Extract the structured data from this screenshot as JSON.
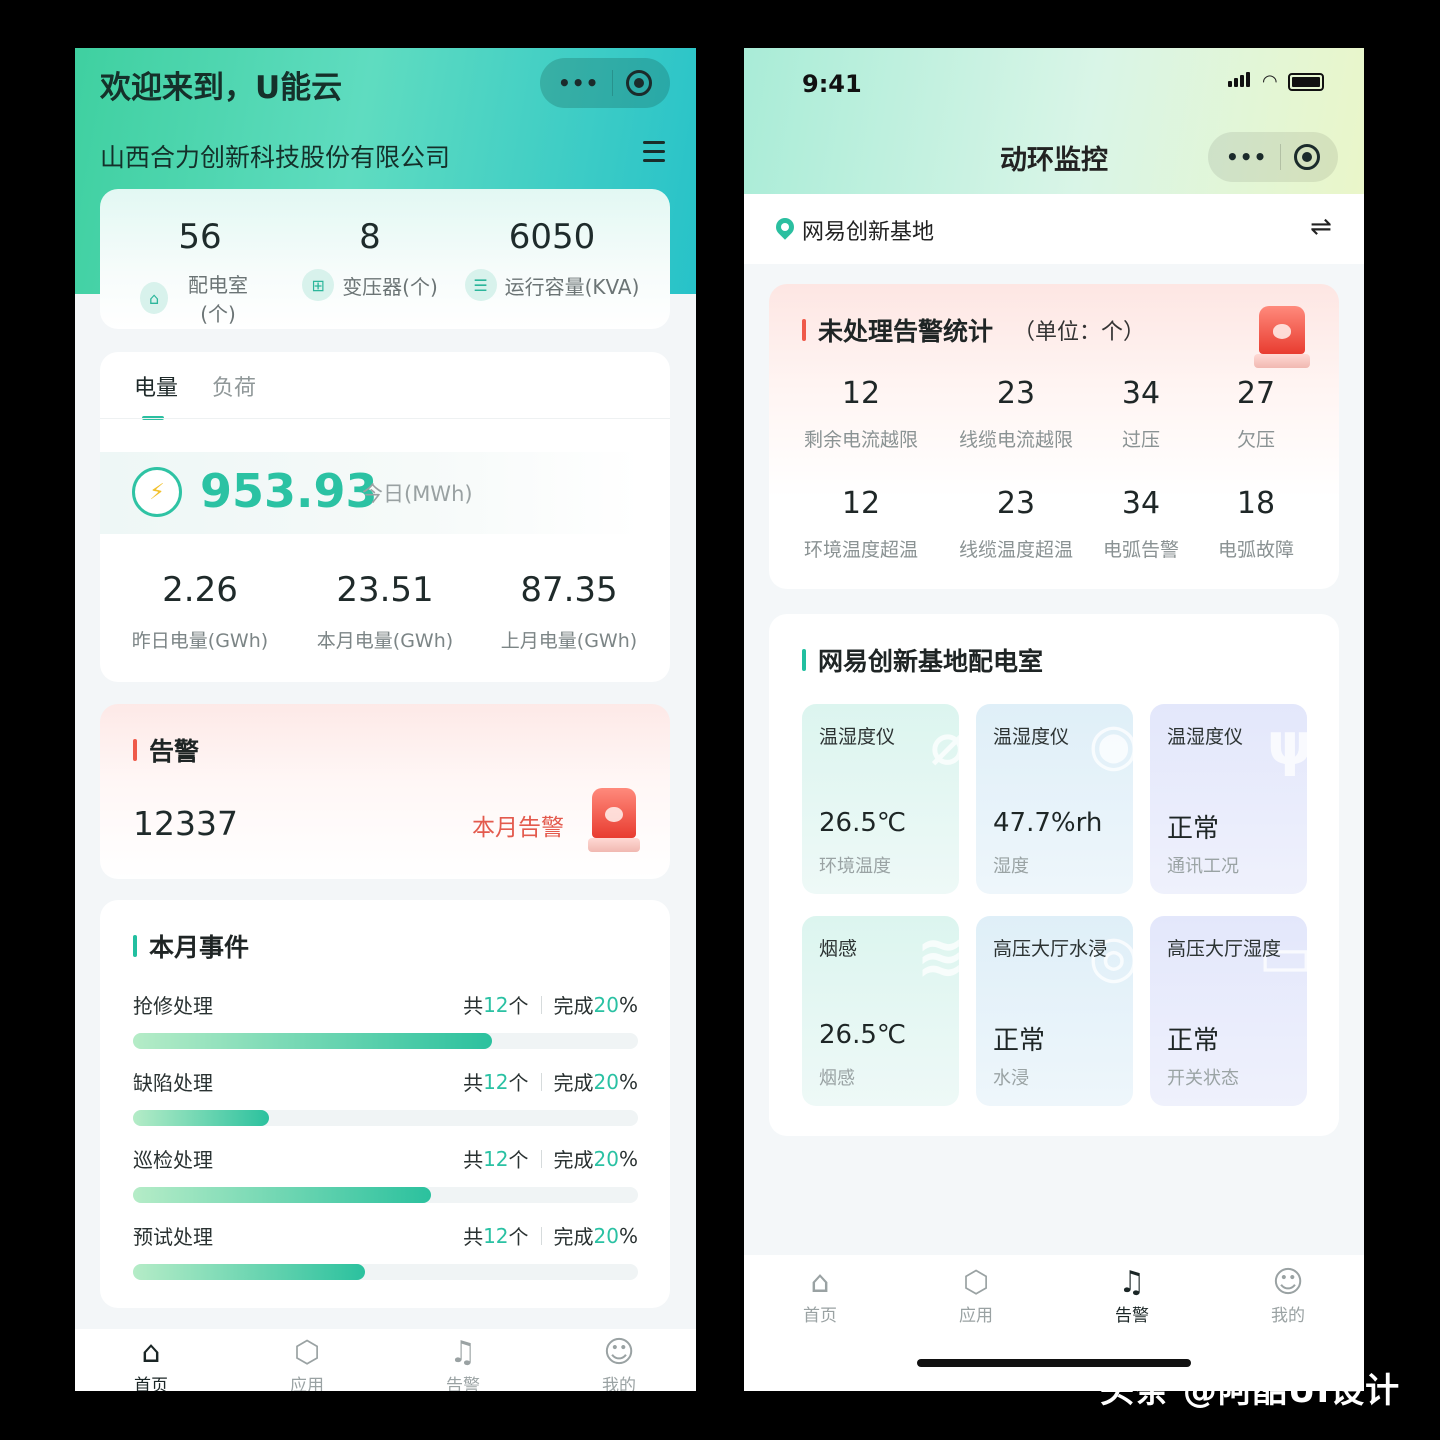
{
  "left": {
    "welcome": "欢迎来到，U能云",
    "company": "山西合力创新科技股份有限公司",
    "stats": [
      {
        "value": "56",
        "label": "配电室(个)",
        "icon": "house-icon"
      },
      {
        "value": "8",
        "label": "变压器(个)",
        "icon": "transformer-icon"
      },
      {
        "value": "6050",
        "label": "运行容量(KVA)",
        "icon": "database-icon"
      }
    ],
    "tabs": {
      "active": "电量",
      "inactive": "负荷"
    },
    "today": {
      "value": "953.93",
      "unit": "今日(MWh)"
    },
    "sub_stats": [
      {
        "value": "2.26",
        "label": "昨日电量(GWh)"
      },
      {
        "value": "23.51",
        "label": "本月电量(GWh)"
      },
      {
        "value": "87.35",
        "label": "上月电量(GWh)"
      }
    ],
    "alarm": {
      "title": "告警",
      "count": "12337",
      "tag": "本月告警"
    },
    "events": {
      "title": "本月事件",
      "items": [
        {
          "name": "抢修处理",
          "total_prefix": "共",
          "total": "12",
          "total_suffix": "个",
          "done_prefix": "完成",
          "done": "20",
          "done_suffix": "%",
          "progress": 0.71
        },
        {
          "name": "缺陷处理",
          "total_prefix": "共",
          "total": "12",
          "total_suffix": "个",
          "done_prefix": "完成",
          "done": "20",
          "done_suffix": "%",
          "progress": 0.27
        },
        {
          "name": "巡检处理",
          "total_prefix": "共",
          "total": "12",
          "total_suffix": "个",
          "done_prefix": "完成",
          "done": "20",
          "done_suffix": "%",
          "progress": 0.59
        },
        {
          "name": "预试处理",
          "total_prefix": "共",
          "total": "12",
          "total_suffix": "个",
          "done_prefix": "完成",
          "done": "20",
          "done_suffix": "%",
          "progress": 0.46
        }
      ]
    },
    "tabbar": [
      "首页",
      "应用",
      "告警",
      "我的"
    ]
  },
  "right": {
    "time": "9:41",
    "nav_title": "动环监控",
    "location": "网易创新基地",
    "pending": {
      "title": "未处理告警统计",
      "unit_note": "（单位：个）",
      "items": [
        {
          "value": "12",
          "label": "剩余电流越限"
        },
        {
          "value": "23",
          "label": "线缆电流越限"
        },
        {
          "value": "34",
          "label": "过压"
        },
        {
          "value": "27",
          "label": "欠压"
        },
        {
          "value": "12",
          "label": "环境温度超温"
        },
        {
          "value": "23",
          "label": "线缆温度超温"
        },
        {
          "value": "34",
          "label": "电弧告警"
        },
        {
          "value": "18",
          "label": "电弧故障"
        }
      ]
    },
    "room": {
      "title": "网易创新基地配电室",
      "tiles": [
        {
          "title": "温湿度仪",
          "value": "26.5℃",
          "sub": "环境温度",
          "tone": "g",
          "icon": "thermometer-icon"
        },
        {
          "title": "温湿度仪",
          "value": "47.7%rh",
          "sub": "湿度",
          "tone": "b",
          "icon": "droplet-icon"
        },
        {
          "title": "温湿度仪",
          "value": "正常",
          "sub": "通讯工况",
          "tone": "p",
          "icon": "antenna-icon"
        },
        {
          "title": "烟感",
          "value": "26.5℃",
          "sub": "烟感",
          "tone": "g",
          "icon": "smoke-icon"
        },
        {
          "title": "高压大厅水浸",
          "value": "正常",
          "sub": "水浸",
          "tone": "b",
          "icon": "water-icon"
        },
        {
          "title": "高压大厅湿度",
          "value": "正常",
          "sub": "开关状态",
          "tone": "p",
          "icon": "switch-icon"
        }
      ]
    },
    "tabbar": [
      "首页",
      "应用",
      "告警",
      "我的"
    ]
  },
  "watermark": "头条 @阿酷UI设计"
}
